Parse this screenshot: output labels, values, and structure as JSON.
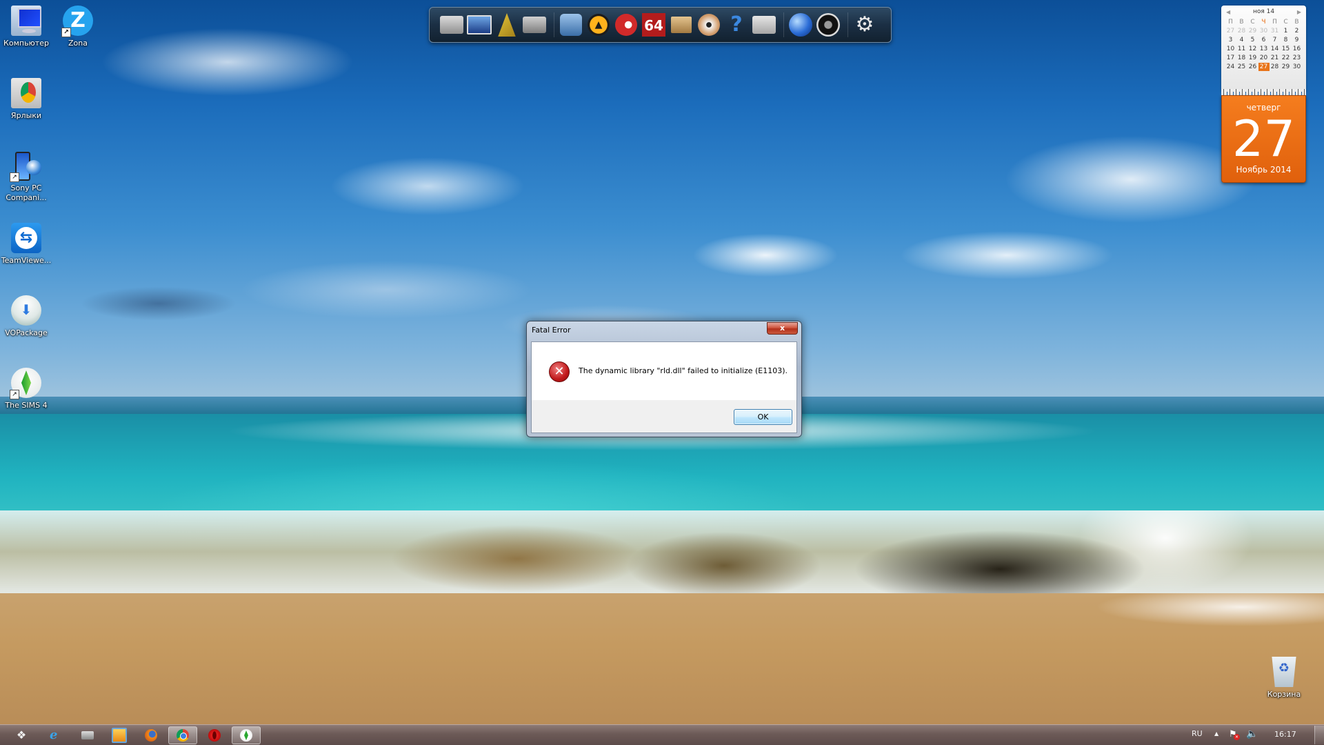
{
  "desktop": {
    "icons": [
      {
        "label": "Компьютер",
        "icon": "computer-icon",
        "shortcut": false
      },
      {
        "label": "Zona",
        "icon": "zona-icon",
        "glyph": "Z",
        "shortcut": true
      },
      {
        "label": "Ярлыки",
        "icon": "shortcuts-folder-icon",
        "shortcut": false
      },
      {
        "label": "Sony PC Compani...",
        "icon": "sony-pc-companion-icon",
        "shortcut": true
      },
      {
        "label": "TeamViewe...",
        "icon": "teamviewer-icon",
        "shortcut": false
      },
      {
        "label": "VOPackage",
        "icon": "vopackage-icon",
        "shortcut": false
      },
      {
        "label": "The SIMS 4",
        "icon": "sims4-icon",
        "shortcut": true
      },
      {
        "label": "Корзина",
        "icon": "recycle-bin-icon",
        "shortcut": false
      }
    ],
    "shortcut_arrow": "↗"
  },
  "dock": {
    "items": [
      {
        "name": "folder-icon"
      },
      {
        "name": "imac-computer-icon"
      },
      {
        "name": "tools-icon"
      },
      {
        "name": "camera-folder-icon"
      },
      {
        "name": "video-player-icon"
      },
      {
        "name": "aimp-icon",
        "glyph": "▲"
      },
      {
        "name": "ccleaner-icon"
      },
      {
        "name": "aida64-icon",
        "glyph": "64"
      },
      {
        "name": "package-box-icon"
      },
      {
        "name": "disc-burner-icon"
      },
      {
        "name": "help-icon",
        "glyph": "?"
      },
      {
        "name": "documents-folder-icon"
      },
      {
        "name": "globe-network-icon"
      },
      {
        "name": "speaker-icon"
      },
      {
        "name": "settings-gears-icon",
        "glyph": "⚙"
      }
    ]
  },
  "calendar": {
    "month_header": "ноя 14",
    "prev_glyph": "◀",
    "next_glyph": "▶",
    "weekdays": [
      "П",
      "В",
      "С",
      "Ч",
      "П",
      "С",
      "В"
    ],
    "today_weekday_index": 3,
    "days": [
      {
        "d": "27",
        "prev": true
      },
      {
        "d": "28",
        "prev": true
      },
      {
        "d": "29",
        "prev": true
      },
      {
        "d": "30",
        "prev": true
      },
      {
        "d": "31",
        "prev": true
      },
      {
        "d": "1"
      },
      {
        "d": "2"
      },
      {
        "d": "3"
      },
      {
        "d": "4"
      },
      {
        "d": "5"
      },
      {
        "d": "6"
      },
      {
        "d": "7"
      },
      {
        "d": "8"
      },
      {
        "d": "9"
      },
      {
        "d": "10"
      },
      {
        "d": "11"
      },
      {
        "d": "12"
      },
      {
        "d": "13"
      },
      {
        "d": "14"
      },
      {
        "d": "15"
      },
      {
        "d": "16"
      },
      {
        "d": "17"
      },
      {
        "d": "18"
      },
      {
        "d": "19"
      },
      {
        "d": "20"
      },
      {
        "d": "21"
      },
      {
        "d": "22"
      },
      {
        "d": "23"
      },
      {
        "d": "24"
      },
      {
        "d": "25"
      },
      {
        "d": "26"
      },
      {
        "d": "27",
        "selected": true
      },
      {
        "d": "28"
      },
      {
        "d": "29"
      },
      {
        "d": "30"
      }
    ],
    "weekday_full": "четверг",
    "day_number": "27",
    "month_year": "Ноябрь 2014",
    "accent_color": "#e8741a"
  },
  "dialog": {
    "title": "Fatal Error",
    "close_glyph": "x",
    "icon": "error-icon",
    "icon_glyph": "✕",
    "message": "The dynamic library \"rld.dll\" failed to initialize (E1103).",
    "ok_label": "OK"
  },
  "taskbar": {
    "start_glyph": "❖",
    "items": [
      {
        "name": "internet-explorer",
        "glyph": "e",
        "active": false
      },
      {
        "name": "file-explorer",
        "active": false
      },
      {
        "name": "media-player",
        "active": false
      },
      {
        "name": "firefox",
        "active": false
      },
      {
        "name": "chrome",
        "active": true
      },
      {
        "name": "opera",
        "active": false
      },
      {
        "name": "sims4",
        "active": true
      }
    ],
    "tray": {
      "language": "RU",
      "overflow_glyph": "▲",
      "action_center_glyph": "⚑",
      "volume_glyph": "🔈",
      "clock": "16:17"
    }
  }
}
